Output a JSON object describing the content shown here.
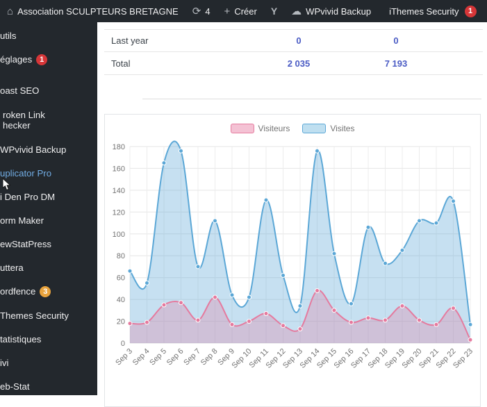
{
  "admin_bar": {
    "site_name": "Association SCULPTEURS BRETAGNE",
    "updates_count": "4",
    "new_label": "Créer",
    "wpvivid_label": "WPvivid Backup",
    "ithemes_label": "iThemes Security",
    "ithemes_badge": "1",
    "badge_color": "#d63638",
    "icons": {
      "home": "⌂",
      "update": "⟳",
      "plus": "+",
      "yoast": "Y",
      "cloud": "☁"
    }
  },
  "sidebar": {
    "items": [
      {
        "label": "utils"
      },
      {
        "label": "églages",
        "badge": "1",
        "badge_color": "#d63638"
      },
      {
        "label": "oast SEO"
      },
      {
        "label": "roken Link\nhecker"
      },
      {
        "label": "WPvivid Backup"
      },
      {
        "label": "uplicator Pro",
        "color": "#72aee6"
      },
      {
        "label": "i Den Pro DM"
      },
      {
        "label": "orm Maker"
      },
      {
        "label": "ewStatPress"
      },
      {
        "label": "uttera"
      },
      {
        "label": "ordfence",
        "badge": "3",
        "badge_color": "#e8a33d"
      },
      {
        "label": "Themes Security"
      },
      {
        "label": "tatistiques"
      },
      {
        "label": "ivi"
      },
      {
        "label": "eb-Stat"
      }
    ]
  },
  "stats_table": {
    "value_color": "#4a5bc4",
    "rows": [
      {
        "label": "Last year",
        "col1": "0",
        "col2": "0"
      },
      {
        "label": "Total",
        "col1": "2 035",
        "col2": "7 193"
      }
    ]
  },
  "chart_data": {
    "type": "area",
    "x": [
      "Sep 3",
      "Sep 4",
      "Sep 5",
      "Sep 6",
      "Sep 7",
      "Sep 8",
      "Sep 9",
      "Sep 10",
      "Sep 11",
      "Sep 12",
      "Sep 13",
      "Sep 14",
      "Sep 15",
      "Sep 16",
      "Sep 17",
      "Sep 18",
      "Sep 19",
      "Sep 20",
      "Sep 21",
      "Sep 22",
      "Sep 23"
    ],
    "series": [
      {
        "name": "Visiteurs",
        "color": "#e57a9e",
        "fill": "rgba(229,122,158,0.30)",
        "swatch": "#f4c2d4",
        "values": [
          18,
          19,
          35,
          37,
          21,
          42,
          17,
          20,
          27,
          16,
          13,
          48,
          30,
          19,
          23,
          21,
          34,
          21,
          17,
          32,
          3
        ]
      },
      {
        "name": "Visites",
        "color": "#5ba7d6",
        "fill": "rgba(91,167,214,0.35)",
        "swatch": "#bfdff0",
        "values": [
          66,
          55,
          165,
          176,
          70,
          112,
          44,
          42,
          131,
          62,
          34,
          176,
          82,
          36,
          106,
          73,
          85,
          112,
          110,
          130,
          17
        ]
      }
    ],
    "ylim": [
      0,
      180
    ],
    "ytick_step": 20,
    "grid": true,
    "legend_position": "top"
  }
}
